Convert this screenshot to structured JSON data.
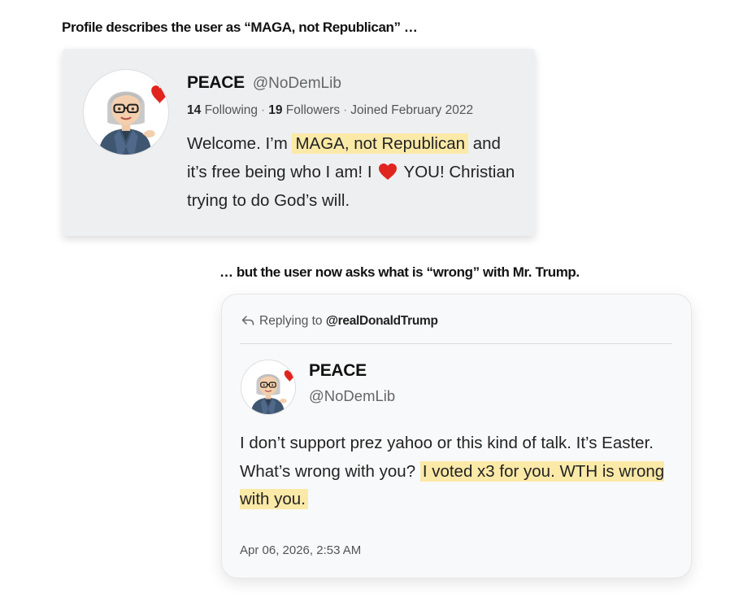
{
  "captions": {
    "top": "Profile describes the user as “MAGA, not Republican” …",
    "middle": "… but the user now asks what is “wrong” with Mr. Trump."
  },
  "profile": {
    "name": "PEACE",
    "handle": "@NoDemLib",
    "following_count": "14",
    "following_label": "Following",
    "followers_count": "19",
    "followers_label": "Followers",
    "separator": "·",
    "joined": "Joined February 2022",
    "bio": {
      "part1": "Welcome. I’m ",
      "highlight": "MAGA, not Republican",
      "part2": " and it’s free being who I am! I ",
      "part3": " YOU! Christian trying to do God’s will."
    },
    "avatar_icon": "memoji-avatar-icon",
    "heart_icon": "red-heart-icon"
  },
  "tweet": {
    "reply_prefix": "Replying to",
    "reply_target": "@realDonaldTrump",
    "name": "PEACE",
    "handle": "@NoDemLib",
    "body": {
      "part1": "I don’t support prez yahoo or this kind of talk. It’s Easter. What’s wrong with you? ",
      "highlight": "I voted x3 for you. WTH is wrong with you."
    },
    "timestamp": "Apr 06, 2026, 2:53 AM",
    "reply_icon": "reply-arrow-icon"
  },
  "colors": {
    "highlight": "#fbe9a8",
    "profile_card_bg": "#eeeff1",
    "tweet_card_bg": "#f8f9fa",
    "heart": "#e0241e"
  }
}
